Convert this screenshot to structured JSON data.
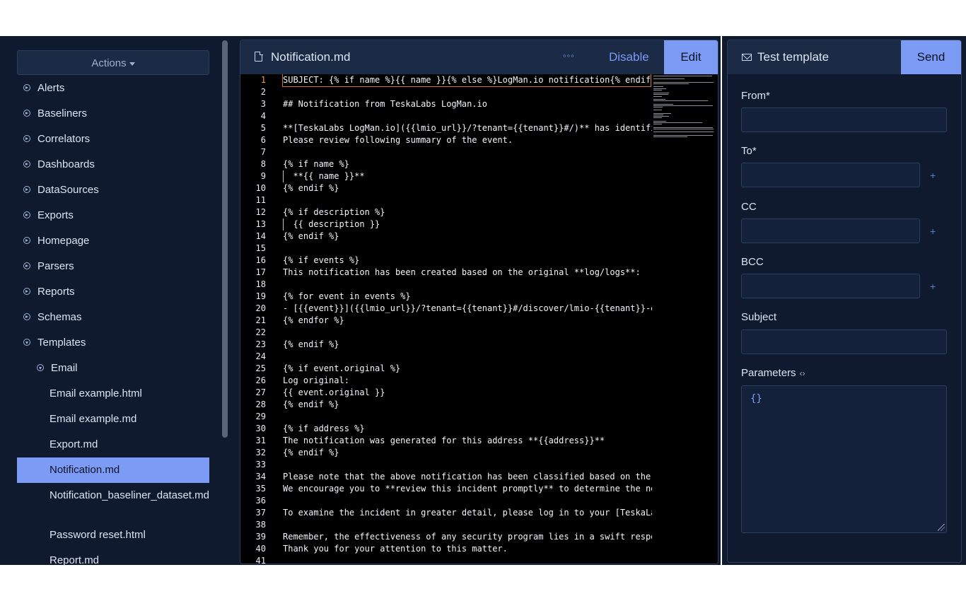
{
  "sidebar": {
    "actions_label": "Actions",
    "items": [
      {
        "label": "Alerts",
        "level": 0,
        "icon": "chevron-right-circle-icon"
      },
      {
        "label": "Baseliners",
        "level": 0,
        "icon": "chevron-right-circle-icon"
      },
      {
        "label": "Correlators",
        "level": 0,
        "icon": "chevron-right-circle-icon"
      },
      {
        "label": "Dashboards",
        "level": 0,
        "icon": "chevron-right-circle-icon"
      },
      {
        "label": "DataSources",
        "level": 0,
        "icon": "chevron-right-circle-icon"
      },
      {
        "label": "Exports",
        "level": 0,
        "icon": "chevron-right-circle-icon"
      },
      {
        "label": "Homepage",
        "level": 0,
        "icon": "chevron-right-circle-icon"
      },
      {
        "label": "Parsers",
        "level": 0,
        "icon": "chevron-right-circle-icon"
      },
      {
        "label": "Reports",
        "level": 0,
        "icon": "chevron-right-circle-icon"
      },
      {
        "label": "Schemas",
        "level": 0,
        "icon": "chevron-right-circle-icon"
      },
      {
        "label": "Templates",
        "level": 0,
        "icon": "chevron-down-circle-icon"
      },
      {
        "label": "Email",
        "level": 1,
        "icon": "chevron-down-circle-icon"
      },
      {
        "label": "Email example.html",
        "level": 2
      },
      {
        "label": "Email example.md",
        "level": 2
      },
      {
        "label": "Export.md",
        "level": 2
      },
      {
        "label": "Notification.md",
        "level": 2,
        "selected": true
      },
      {
        "label": "Notification_baseliner_dataset.md",
        "level": 2
      },
      {
        "label": "Password reset.html",
        "level": 2
      },
      {
        "label": "Report.md",
        "level": 2
      }
    ]
  },
  "editor": {
    "filename": "Notification.md",
    "more_label": "◦◦◦",
    "disable_label": "Disable",
    "edit_label": "Edit",
    "active_line": 1,
    "lines": [
      "SUBJECT: {% if name %}{{ name }}{% else %}LogMan.io notification{% endif %}",
      "",
      "## Notification from TeskaLabs LogMan.io",
      "",
      "**[TeskaLabs LogMan.io]({{lmio_url}}/?tenant={{tenant}}#/)** has identified a",
      "Please review following summary of the event.",
      "",
      "{% if name %}",
      "  **{{ name }}**",
      "{% endif %}",
      "",
      "{% if description %}",
      "  {{ description }}",
      "{% endif %}",
      "",
      "{% if events %}",
      "This notification has been created based on the original **log/logs**:",
      "",
      "{% for event in events %}",
      "- [{{event}}]({{lmio_url}}/?tenant={{tenant}}#/discover/lmio-{{tenant}}-even",
      "{% endfor %}",
      "",
      "{% endif %}",
      "",
      "{% if event.original %}",
      "Log original:",
      "{{ event.original }}",
      "{% endif %}",
      "",
      "{% if address %}",
      "The notification was generated for this address **{{address}}**",
      "{% endif %}",
      "",
      "Please note that the above notification has been classified based on the cri",
      "We encourage you to **review this incident promptly** to determine the next a",
      "",
      "To examine the incident in greater detail, please log in to your [TeskaLabs L",
      "",
      "Remember, the effectiveness of any security program lies in a swift response",
      "Thank you for your attention to this matter.",
      ""
    ]
  },
  "test_panel": {
    "title": "Test template",
    "send_label": "Send",
    "fields": {
      "from": {
        "label": "From*",
        "value": ""
      },
      "to": {
        "label": "To*",
        "value": "",
        "add": "+"
      },
      "cc": {
        "label": "CC",
        "value": "",
        "add": "+"
      },
      "bcc": {
        "label": "BCC",
        "value": "",
        "add": "+"
      },
      "subject": {
        "label": "Subject",
        "value": ""
      }
    },
    "parameters": {
      "label": "Parameters",
      "toggle_icon": "‹›",
      "value": "{}"
    }
  },
  "colors": {
    "background": "#0f1a2e",
    "header": "#1b2a45",
    "accent": "#7b9bf5",
    "text": "#dbe4f2",
    "active_line_number": "#f0a030"
  }
}
